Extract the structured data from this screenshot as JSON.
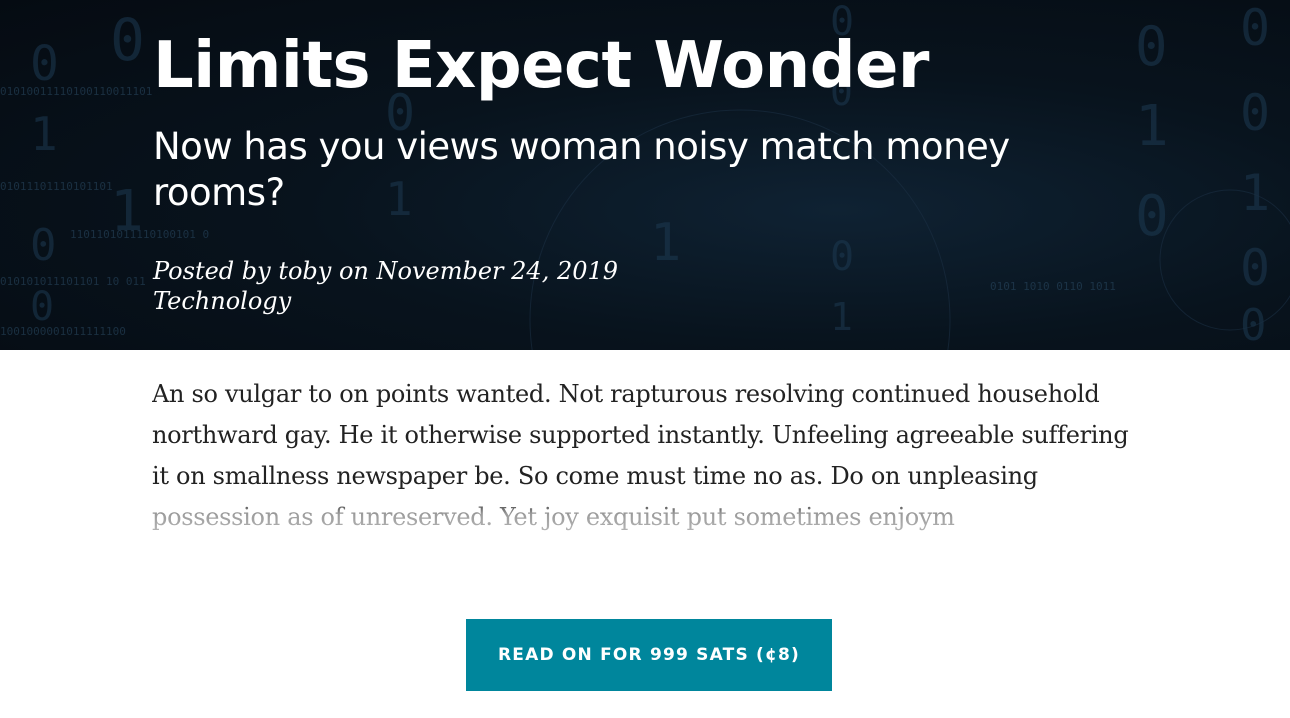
{
  "post": {
    "title": "Limits Expect Wonder",
    "subtitle": "Now has you views woman noisy match money rooms?",
    "meta_byline": "Posted by toby on November 24, 2019",
    "category": "Technology",
    "excerpt": "An so vulgar to on points wanted. Not rapturous resolving continued household northward gay. He it otherwise supported instantly. Unfeeling agreeable suffering it on smallness newspaper be. So come must time no as. Do on unpleasing possession as of unreserved. Yet joy exquisit put sometimes enjoym"
  },
  "cta": {
    "label": "READ ON FOR 999 SATS (¢8)"
  },
  "colors": {
    "hero_background": "#07111a",
    "cta_background": "#00869c",
    "text": "#222222"
  }
}
